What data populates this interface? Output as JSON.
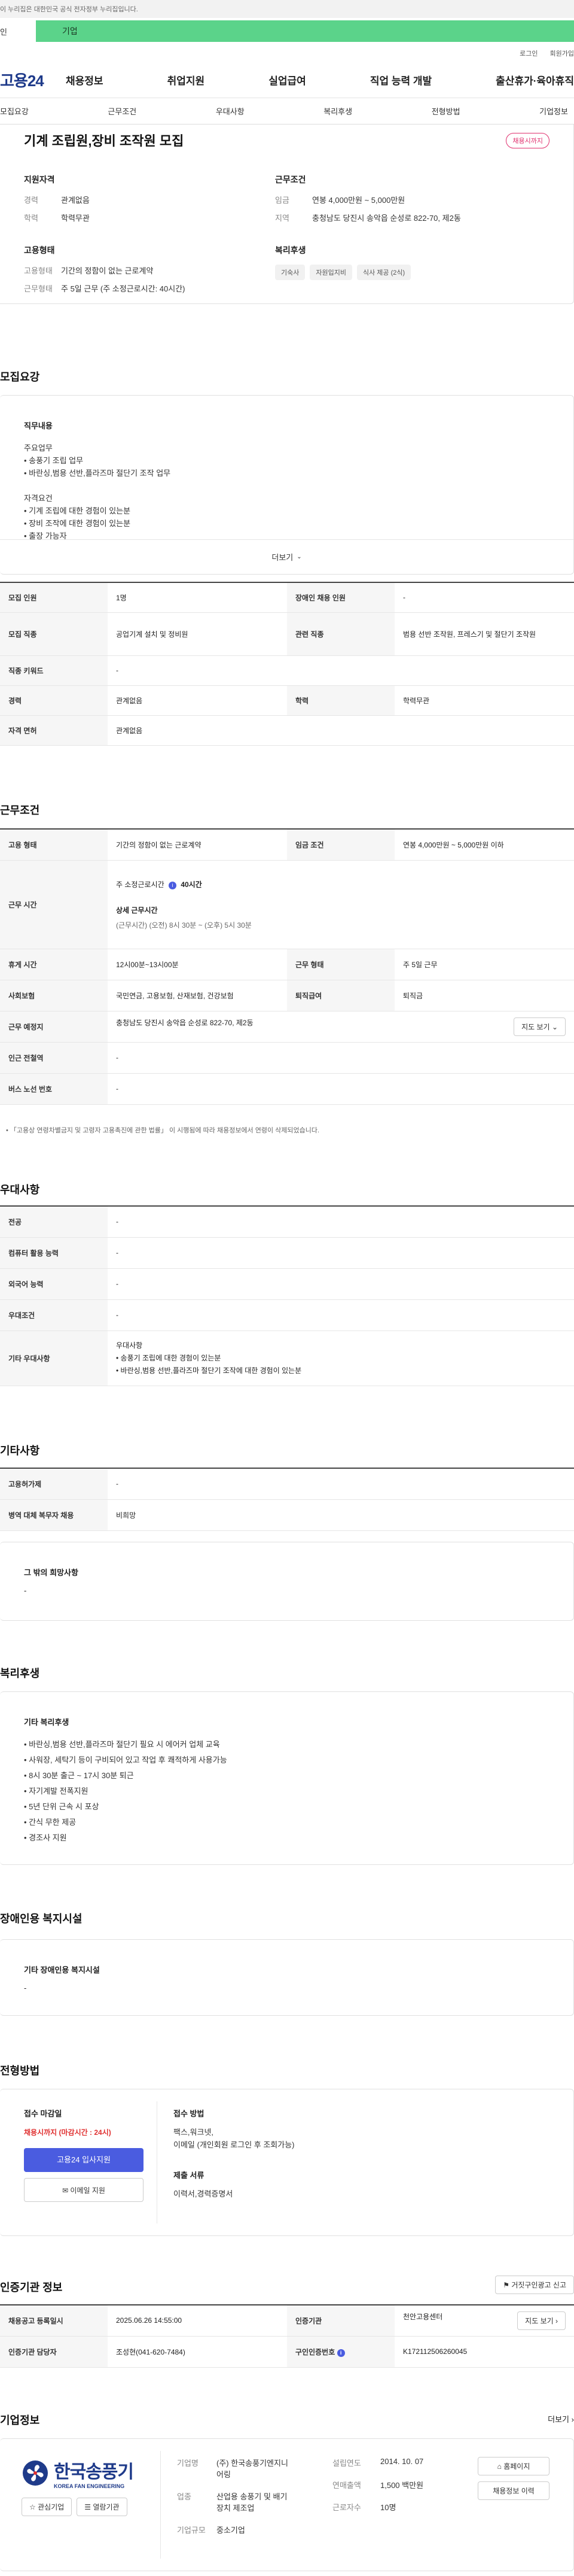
{
  "gov_banner": {
    "text": "이 누리집은 대한민국 공식 전자정부 누리집입니다.",
    "left_label": "인",
    "strip_label": "기업"
  },
  "util": {
    "login": "로그인",
    "join": "회원가입"
  },
  "gnb": {
    "logo": "고용24",
    "menu": [
      "채용정보",
      "취업지원",
      "실업급여",
      "직업 능력 개발",
      "출산휴가·육아휴직"
    ]
  },
  "subnav": [
    "모집요강",
    "근무조건",
    "우대사항",
    "복리후생",
    "전형방법",
    "기업정보"
  ],
  "job": {
    "title": "기계 조립원,장비 조작원 모집",
    "status_badge": "채용시까지",
    "qualification": {
      "heading": "지원자격",
      "rows": [
        {
          "k": "경력",
          "v": "관계없음"
        },
        {
          "k": "학력",
          "v": "학력무관"
        }
      ]
    },
    "conditions": {
      "heading": "근무조건",
      "rows": [
        {
          "k": "임금",
          "v": "연봉 4,000만원 ~ 5,000만원"
        },
        {
          "k": "지역",
          "v": "충청남도 당진시 송악읍 순성로 822-70, 제2동"
        }
      ]
    },
    "employment": {
      "heading": "고용형태",
      "rows": [
        {
          "k": "고용형태",
          "v": "기간의 정함이 없는 근로계약"
        },
        {
          "k": "근무형태",
          "v": "주 5일 근무 (주 소정근로시간: 40시간)"
        }
      ]
    },
    "welfare": {
      "heading": "복리후생",
      "tags": [
        "기숙사",
        "자원입지비",
        "식사 제공 (2식)"
      ]
    }
  },
  "recruit": {
    "heading": "모집요강",
    "duty_title": "직무내용",
    "duty_lines": [
      "주요업무",
      "• 송풍기 조립 업무",
      "• 바란싱,범용 선반,플라즈마 절단기 조작 업무",
      "",
      "자격요건",
      "• 기계 조립에 대한 경험이 있는분",
      "• 장비 조작에 대한 경험이 있는분",
      "• 출장 가능자"
    ],
    "more": "더보기",
    "table": [
      {
        "th1": "모집 인원",
        "td1": "1명",
        "th2": "장애인 채용 인원",
        "td2": "-"
      },
      {
        "th1": "모집 직종",
        "td1": "공업기계 설치 및 정비원",
        "th2": "관련 직종",
        "td2": "범용 선반 조작원, 프레스기 및 절단기 조작원"
      },
      {
        "th1": "직종 키워드",
        "td1": "-"
      },
      {
        "th1": "경력",
        "td1": "관계없음",
        "th2": "학력",
        "td2": "학력무관"
      },
      {
        "th1": "자격 면허",
        "td1": "관계없음"
      }
    ]
  },
  "work": {
    "heading": "근무조건",
    "employment_type": {
      "th": "고용 형태",
      "td": "기간의 정함이 없는 근로계약",
      "th2": "임금 조건",
      "td2": "연봉 4,000만원 ~ 5,000만원 이하"
    },
    "work_time": {
      "th": "근무 시간",
      "weekly": "주 소정근로시간",
      "weekly_hours": "40시간",
      "detail_title": "상세 근무시간",
      "detail": "(근무시간) (오전) 8시 30분 ~ (오후) 5시 30분"
    },
    "rest": {
      "th": "휴게 시간",
      "td": "12시00분~13시00분",
      "th2": "근무 형태",
      "td2": "주 5일 근무"
    },
    "insurance": {
      "th": "사회보험",
      "td": "국민연금, 고용보험, 산재보험, 건강보험",
      "th2": "퇴직급여",
      "td2": "퇴직금"
    },
    "location": {
      "th": "근무 예정지",
      "td": "충청남도 당진시 송악읍 순성로 822-70, 제2동",
      "map_btn": "지도 보기"
    },
    "subway": {
      "th": "인근 전철역",
      "td": "-"
    },
    "bus": {
      "th": "버스 노선 번호",
      "td": "-"
    },
    "note": "「고용상 연령차별금지 및 고령자 고용촉진에 관한 법률」 이 시행됨에 따라 채용정보에서 연령이 삭제되었습니다."
  },
  "prefer": {
    "heading": "우대사항",
    "rows": [
      {
        "th": "전공",
        "td": "-"
      },
      {
        "th": "컴퓨터 활용 능력",
        "td": "-"
      },
      {
        "th": "외국어 능력",
        "td": "-"
      },
      {
        "th": "우대조건",
        "td": "-"
      }
    ],
    "other_th": "기타 우대사항",
    "other_lines": [
      "우대사항",
      "• 송풍기 조립에 대한 경험이 있는분",
      "• 바란싱,범용 선반,플라즈마 절단기 조작에 대한 경험이 있는분"
    ]
  },
  "etc": {
    "heading": "기타사항",
    "rows": [
      {
        "th": "고용허가제",
        "td": "-"
      },
      {
        "th": "병역 대체 복무자 채용",
        "td": "비희망"
      }
    ],
    "hope_title": "그 밖의 희망사항",
    "hope_value": "-"
  },
  "welfare": {
    "heading": "복리후생",
    "box_title": "기타 복리후생",
    "lines": [
      "• 바란싱,범용 선반,플라즈마 절단기 필요 시 에어커 업체 교육",
      "• 사워장, 세탁기 등이 구비되어 있고 작업 후 쾌적하게 사용가능",
      "• 8시 30분 출근 ~ 17시 30분 퇴근",
      "• 자기계발 전폭지원",
      "• 5년 단위 근속 시 포상",
      "• 간식 무한 제공",
      "• 경조사 지원"
    ]
  },
  "disabled": {
    "heading": "장애인용 복지시설",
    "box_title": "기타 장애인용 복지시설",
    "value": "-"
  },
  "selection": {
    "heading": "전형방법",
    "deadline_title": "접수 마감일",
    "deadline": "채용시까지 (마감시간 : 24시)",
    "apply_btn": "고용24 입사지원",
    "email_btn": "이메일 지원",
    "method_title": "접수 방법",
    "method": [
      "팩스,워크넷,",
      "이메일 (개인회원 로그인 후 조회가능)"
    ],
    "docs_title": "제출 서류",
    "docs": "이력서,경력증명서"
  },
  "certify": {
    "heading": "인증기관 정보",
    "report_btn": "거짓구인광고 신고",
    "rows": [
      {
        "th1": "채용공고 등록일시",
        "td1": "2025.06.26 14:55:00",
        "th2": "인증기관",
        "td2": "천안고용센터",
        "btn": "지도 보기"
      },
      {
        "th1": "인증기관 담당자",
        "td1": "조성현(041-620-7484)",
        "th2": "구인인증번호",
        "td2": "K172112506260045"
      }
    ]
  },
  "company": {
    "heading": "기업정보",
    "more": "더보기",
    "logo_kr": "한국송풍기",
    "logo_en": "KOREA FAN ENGINEERING",
    "interest_btn": "관심기업",
    "list_btn": "열람기관",
    "fields": [
      {
        "k": "기업명",
        "v": "(주) 한국송풍기엔지니어링"
      },
      {
        "k": "업종",
        "v": "산업용 송풍기 및 배기장치 제조업"
      },
      {
        "k": "기업규모",
        "v": "중소기업"
      }
    ],
    "fields2": [
      {
        "k": "설립연도",
        "v": "2014. 10. 07"
      },
      {
        "k": "연매출액",
        "v": "1,500 백만원"
      },
      {
        "k": "근로자수",
        "v": "10명"
      }
    ],
    "home_btn": "홈페이지",
    "jobs_btn": "채용정보 이력"
  },
  "colors": {
    "accent": "#4a5ce0",
    "pink": "#e0306e",
    "banner_green": "#5bd38a",
    "red": "#e03030"
  }
}
